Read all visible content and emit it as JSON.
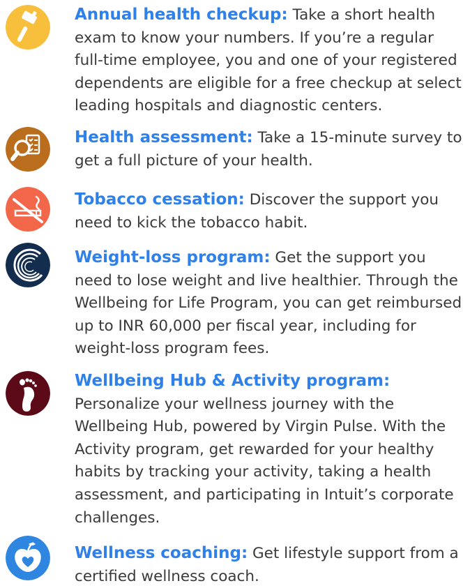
{
  "colors": {
    "title": "#2f80e8",
    "body": "#3a3a3a"
  },
  "items": [
    {
      "title": "Annual health checkup:",
      "text": " Take a short health exam to know your numbers. If you’re a regular full-time employee, you and one of your registered dependents are eligible for a free checkup at select leading hospitals and diagnostic centers.",
      "icon": "hammer-icon",
      "icon_color": "#f7bf3b"
    },
    {
      "title": "Health assessment:",
      "text": " Take a 15-minute survey to get a full picture of your health.",
      "icon": "magnifier-checklist-icon",
      "icon_color": "#b96d1d"
    },
    {
      "title": "Tobacco cessation:",
      "text": " Discover the support you need to kick the tobacco habit.",
      "icon": "no-smoking-icon",
      "icon_color": "#f2664a"
    },
    {
      "title": "Weight-loss program:",
      "text": " Get the support you need to lose weight and live healthier. Through the Wellbeing for Life Program, you can get reimbursed up to INR 60,000 per fiscal year, including for weight-loss program fees.",
      "icon": "swirl-icon",
      "icon_color": "#132d4e"
    },
    {
      "title": "Wellbeing Hub & Activity program:",
      "text": "Personalize your wellness journey with the Wellbeing Hub, powered by Virgin Pulse. With the Activity program, get rewarded for your healthy habits by tracking your activity, taking a health assessment, and participating in Intuit’s corporate challenges.",
      "icon": "footprint-icon",
      "icon_color": "#5c0a18"
    },
    {
      "title": "Wellness coaching:",
      "text": " Get lifestyle support from a certified wellness coach.",
      "icon": "apple-heart-icon",
      "icon_color": "#2e86e0"
    }
  ]
}
